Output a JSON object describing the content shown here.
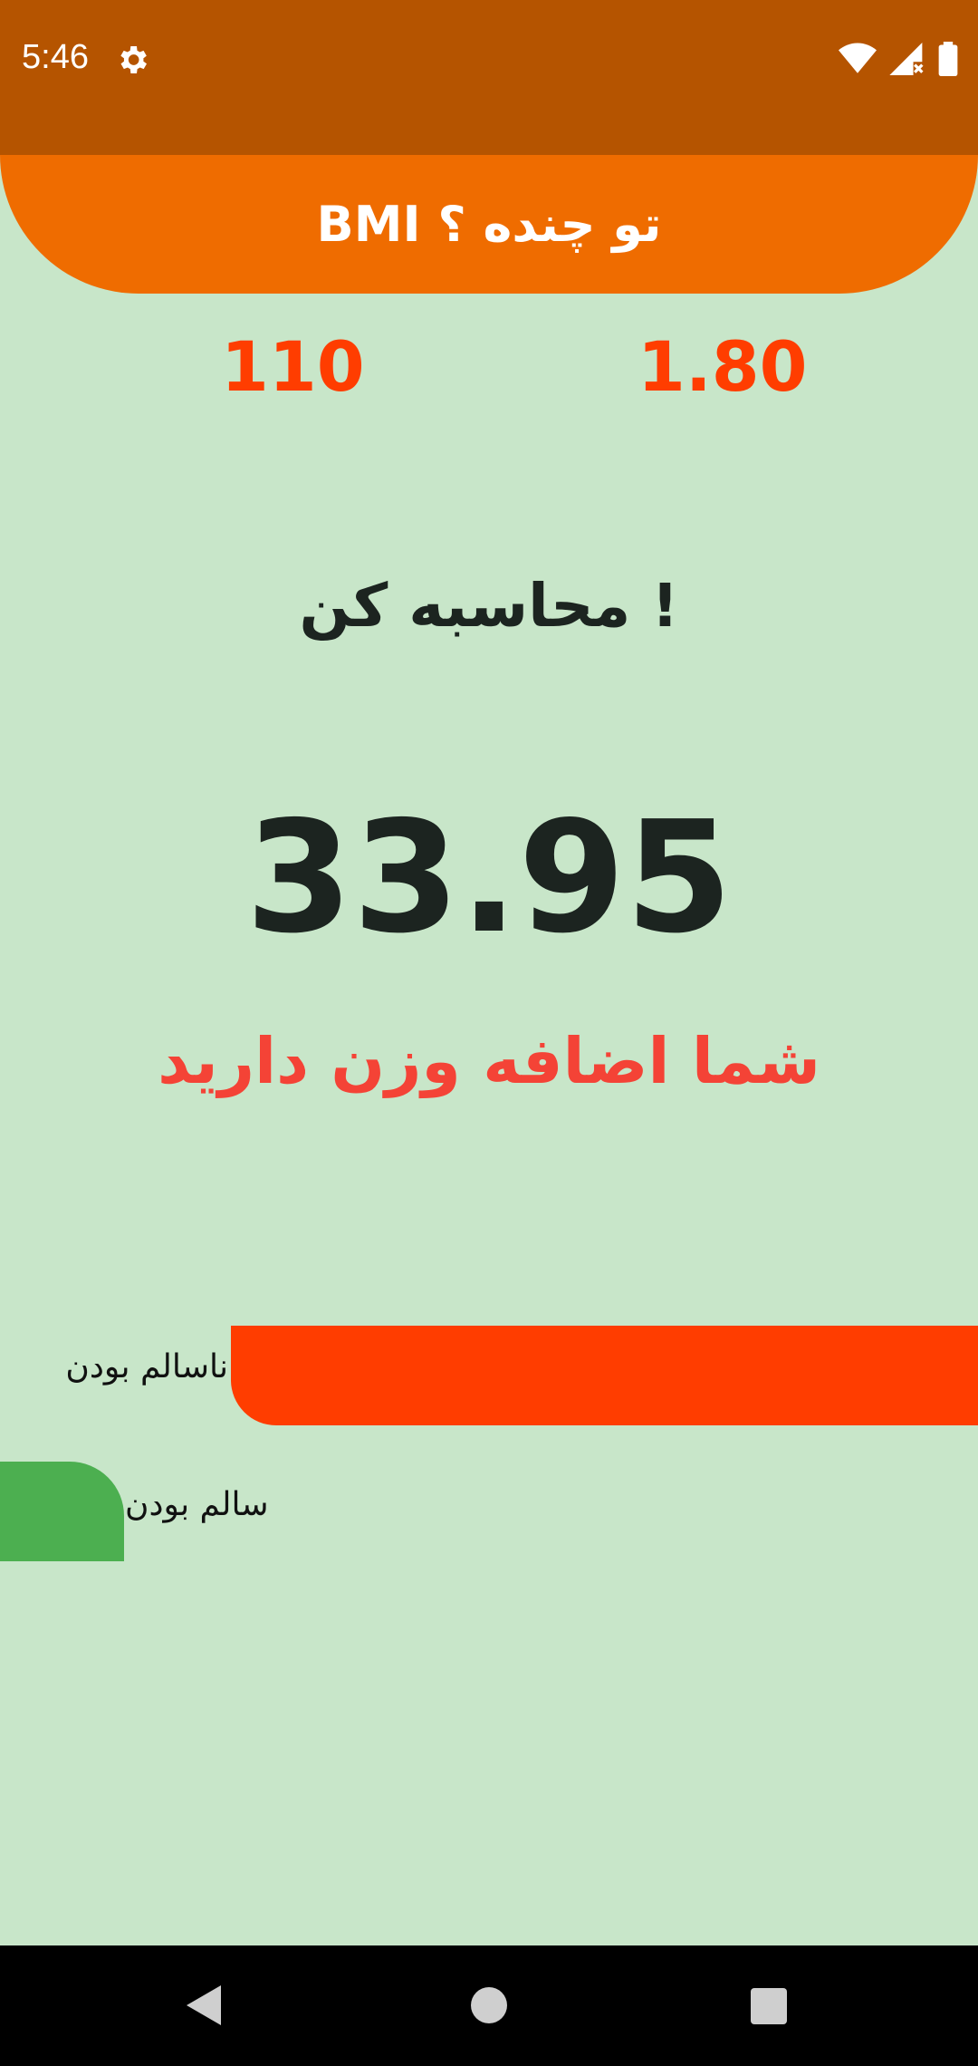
{
  "status_bar": {
    "time": "5:46",
    "icons": [
      "settings-icon",
      "wifi-icon",
      "signal-icon",
      "battery-icon"
    ]
  },
  "app_bar": {
    "title": "BMI تو چنده ؟"
  },
  "inputs": {
    "weight": "110",
    "height": "1.80"
  },
  "calculate_button": {
    "label": "محاسبه کن !"
  },
  "result": {
    "bmi": "33.95",
    "message": "شما اضافه وزن دارید"
  },
  "comparison": {
    "unhealthy_label": "ناسالم بودن",
    "healthy_label": "سالم بودن"
  },
  "nav_bar": {
    "icons": [
      "back-icon",
      "home-icon",
      "recents-icon"
    ]
  },
  "colors": {
    "status_bar": "#B55400",
    "app_bar": "#EF6C00",
    "background": "#C8E6C9",
    "input_value": "#FF3D00",
    "message": "#F44336",
    "unhealthy_bar": "#FF3D00",
    "healthy_bar": "#4CAF50"
  }
}
